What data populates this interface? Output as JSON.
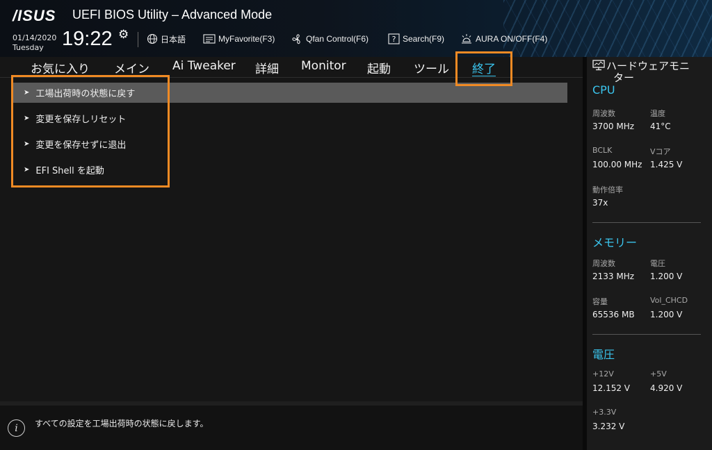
{
  "header": {
    "logo": "/ISUS",
    "title": "UEFI BIOS Utility – Advanced Mode",
    "date": "01/14/2020",
    "weekday": "Tuesday",
    "time": "19:22",
    "items": {
      "language": "日本語",
      "myfavorite": "MyFavorite(F3)",
      "qfan": "Qfan Control(F6)",
      "search": "Search(F9)",
      "aura": "AURA ON/OFF(F4)"
    }
  },
  "tabs": [
    "お気に入り",
    "メイン",
    "Ai Tweaker",
    "詳細",
    "Monitor",
    "起動",
    "ツール",
    "終了"
  ],
  "active_tab": "終了",
  "menu": [
    "工場出荷時の状態に戻す",
    "変更を保存しリセット",
    "変更を保存せずに退出",
    "EFI Shell を起動"
  ],
  "help_text": "すべての設定を工場出荷時の状態に戻します。",
  "monitor": {
    "title_line1": "ハードウェアモニ",
    "title_line2": "ター",
    "cpu": {
      "heading": "CPU",
      "freq_label": "周波数",
      "freq": "3700 MHz",
      "temp_label": "温度",
      "temp": "41°C",
      "bclk_label": "BCLK",
      "bclk": "100.00 MHz",
      "vcore_label": "Vコア",
      "vcore": "1.425 V",
      "ratio_label": "動作倍率",
      "ratio": "37x"
    },
    "memory": {
      "heading": "メモリー",
      "freq_label": "周波数",
      "freq": "2133 MHz",
      "volt_label": "電圧",
      "volt": "1.200 V",
      "cap_label": "容量",
      "cap": "65536 MB",
      "chcd_label": "Vol_CHCD",
      "chcd": "1.200 V"
    },
    "voltage": {
      "heading": "電圧",
      "v12_label": "+12V",
      "v12": "12.152 V",
      "v5_label": "+5V",
      "v5": "4.920 V",
      "v33_label": "+3.3V",
      "v33": "3.232 V"
    }
  },
  "colors": {
    "accent": "#3bc5ee",
    "highlight_box": "#f08a24",
    "selected_row": "#5a5a5a"
  }
}
